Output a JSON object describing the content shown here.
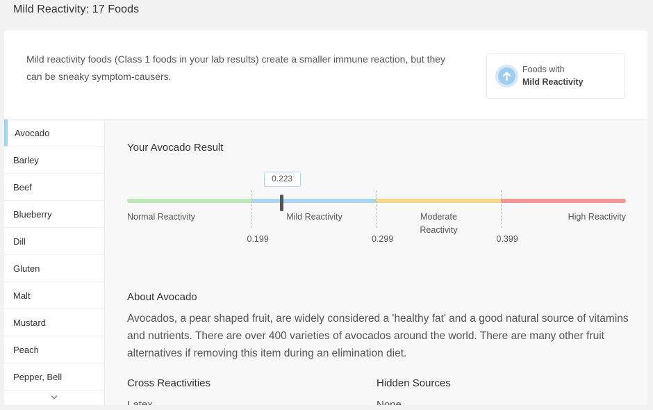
{
  "header": {
    "title": "Mild Reactivity: 17 Foods"
  },
  "intro": {
    "text": "Mild reactivity foods (Class 1 foods in your lab results) create a smaller immune reaction, but they can be sneaky symptom-causers.",
    "badge": {
      "icon": "arrow-up-circle-icon",
      "line1": "Foods with",
      "line2": "Mild Reactivity",
      "color": "#9fcdf1"
    }
  },
  "sidebar": {
    "items": [
      {
        "label": "Avocado",
        "active": true
      },
      {
        "label": "Barley",
        "active": false
      },
      {
        "label": "Beef",
        "active": false
      },
      {
        "label": "Blueberry",
        "active": false
      },
      {
        "label": "Dill",
        "active": false
      },
      {
        "label": "Gluten",
        "active": false
      },
      {
        "label": "Malt",
        "active": false
      },
      {
        "label": "Mustard",
        "active": false
      },
      {
        "label": "Peach",
        "active": false
      },
      {
        "label": "Pepper, Bell",
        "active": false
      }
    ],
    "more_icon": "chevron-down-icon",
    "more_glyph": "⌄"
  },
  "result": {
    "title": "Your Avocado Result",
    "value": 0.223,
    "value_label": "0.223",
    "scale": {
      "min": 0.099,
      "max": 0.499,
      "zones": [
        {
          "label": "Normal Reactivity",
          "color": "#bde7b7"
        },
        {
          "label": "Mild Reactivity",
          "color": "#abd6f3"
        },
        {
          "label": "Moderate Reactivity",
          "line1": "Moderate",
          "line2": "Reactivity",
          "color": "#f8d68c"
        },
        {
          "label": "High Reactivity",
          "color": "#f39595"
        }
      ],
      "thresholds": [
        {
          "value": 0.199,
          "label": "0.199"
        },
        {
          "value": 0.299,
          "label": "0.299"
        },
        {
          "value": 0.399,
          "label": "0.399"
        }
      ]
    }
  },
  "about": {
    "title": "About Avocado",
    "text": "Avocados, a pear shaped fruit, are widely considered a 'healthy fat' and a good natural source of vitamins and nutrients. There are over 400 varieties of avocados around the world. There are many other fruit alternatives if removing this item during an elimination diet."
  },
  "details": {
    "cross_title": "Cross Reactivities",
    "cross_value": "Latex",
    "hidden_title": "Hidden Sources",
    "hidden_value": "None"
  }
}
